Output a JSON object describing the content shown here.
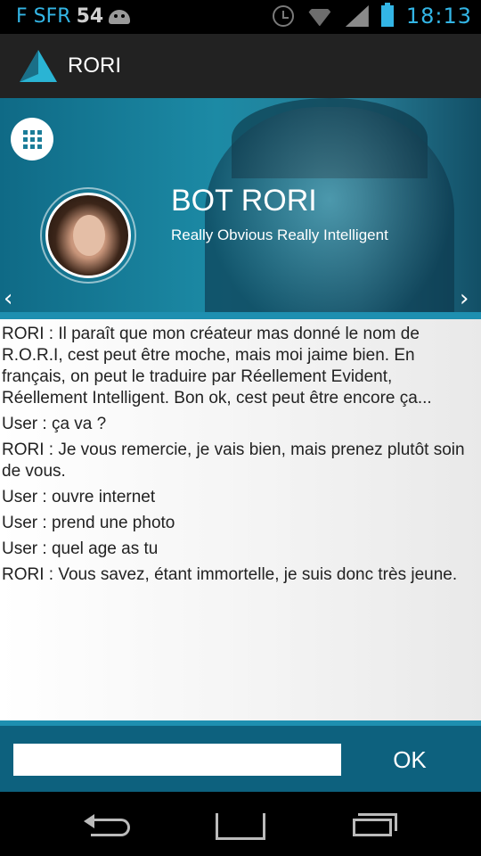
{
  "status_bar": {
    "carrier": "F SFR",
    "notification_count": "54",
    "time": "18:13"
  },
  "action_bar": {
    "title": "RORI"
  },
  "header": {
    "bot_name": "BOT RORI",
    "subtitle": "Really Obvious Really Intelligent",
    "prev_glyph": "‹",
    "next_glyph": "›"
  },
  "chat": {
    "messages": [
      "RORI : Il paraît que mon créateur mas donné le nom de R.O.R.I, cest peut être moche, mais moi jaime bien. En français, on peut le traduire par Réellement Evident, Réellement Intelligent. Bon ok, cest peut être encore ça...",
      "User : ça va ?",
      "RORI : Je vous remercie, je vais bien, mais prenez plutôt soin de vous.",
      "User : ouvre internet",
      "User : prend une photo",
      "User : quel age as tu",
      "RORI : Vous savez, étant immortelle, je suis donc très jeune."
    ]
  },
  "input_bar": {
    "value": "",
    "ok_label": "OK"
  },
  "colors": {
    "accent": "#1e8fb0",
    "input_bar_bg": "#0d617e",
    "status_blue": "#33b5e5"
  },
  "icons": {
    "status": [
      "android-icon",
      "alarm-icon",
      "wifi-icon",
      "signal-icon",
      "battery-charging-icon"
    ],
    "navigation": [
      "back-icon",
      "home-icon",
      "recents-icon"
    ],
    "menu": "grid-icon"
  }
}
